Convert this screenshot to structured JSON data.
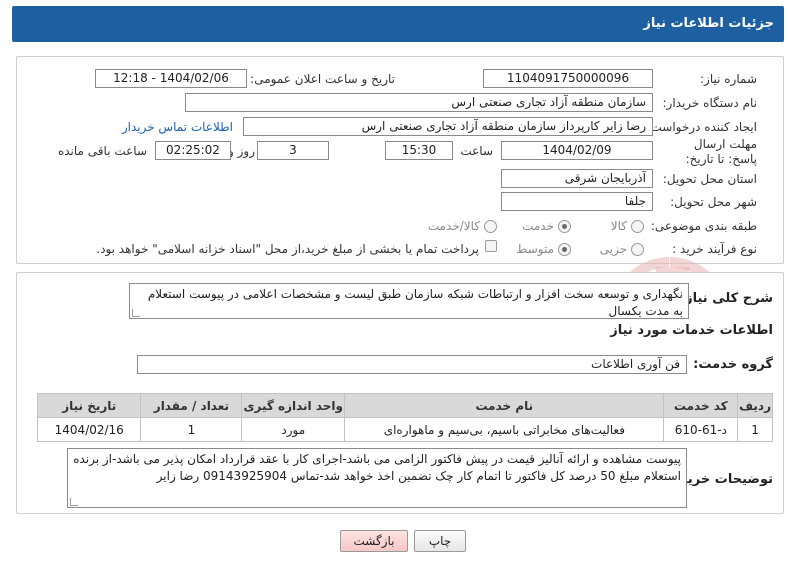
{
  "header": {
    "title": "جزئیات اطلاعات نیاز"
  },
  "fields": {
    "need_number_label": "شماره نیاز:",
    "need_number": "1104091750000096",
    "announce_label": "تاریخ و ساعت اعلان عمومی:",
    "announce_value": "1404/02/06 - 12:18",
    "buyer_org_label": "نام دستگاه خریدار:",
    "buyer_org": "سازمان منطقه آزاد تجاری صنعتی ارس",
    "requester_label": "ایجاد کننده درخواست:",
    "requester": "رضا زایر کارپرداز سازمان منطقه آزاد تجاری صنعتی ارس",
    "contact_link": "اطلاعات تماس خریدار",
    "deadline_label": "مهلت ارسال پاسخ: تا تاریخ:",
    "deadline_date": "1404/02/09",
    "time_label": "ساعت",
    "deadline_time": "15:30",
    "days_value": "3",
    "days_label": "روز و",
    "remaining_time": "02:25:02",
    "remaining_label": "ساعت باقی مانده",
    "province_label": "استان محل تحویل:",
    "province": "آذربایجان شرقی",
    "city_label": "شهر محل تحویل:",
    "city": "جلفا",
    "category_label": "طبقه بندی موضوعی:",
    "category_options": [
      "کالا",
      "خدمت",
      "کالا/خدمت"
    ],
    "category_selected": "خدمت",
    "process_label": "نوع فرآیند خرید :",
    "process_options": [
      "جزیی",
      "متوسط"
    ],
    "process_selected": "متوسط",
    "payment_note": "پرداخت تمام یا بخشی از مبلغ خرید،از محل \"اسناد خزانه اسلامی\" خواهد بود."
  },
  "summary": {
    "label": "شرح کلی نیاز:",
    "text": "نگهداری و توسعه سخت افزار و ارتباطات شبکه سازمان طبق لیست و مشخصات اعلامی در پیوست استعلام به مدت یکسال"
  },
  "services": {
    "section_title": "اطلاعات خدمات مورد نیاز",
    "group_label": "گروه خدمت:",
    "group_value": "فن آوری اطلاعات",
    "table": {
      "headers": [
        "ردیف",
        "کد خدمت",
        "نام خدمت",
        "واحد اندازه گیری",
        "تعداد / مقدار",
        "تاریخ نیاز"
      ],
      "rows": [
        [
          "1",
          "د-61-610",
          "فعالیت‌های مخابراتی باسیم، بی‌سیم و ماهواره‌ای",
          "مورد",
          "1",
          "1404/02/16"
        ]
      ]
    }
  },
  "buyer_notes": {
    "label": "توضیحات خریدار:",
    "text": "پیوست مشاهده و ارائه آنالیز قیمت در پیش فاکتور الزامی می باشد-اجرای کار با عقد قرارداد امکان پذیر می باشد-از برنده استعلام مبلغ 50 درصد کل فاکتور تا اتمام کار چک تضمین اخذ خواهد شد-تماس 09143925904 رضا زایر"
  },
  "buttons": {
    "print": "چاپ",
    "back": "بازگشت"
  },
  "colors": {
    "header_bg": "#1d5fa1",
    "link": "#1f5fb5",
    "watermark": "#d03030"
  }
}
